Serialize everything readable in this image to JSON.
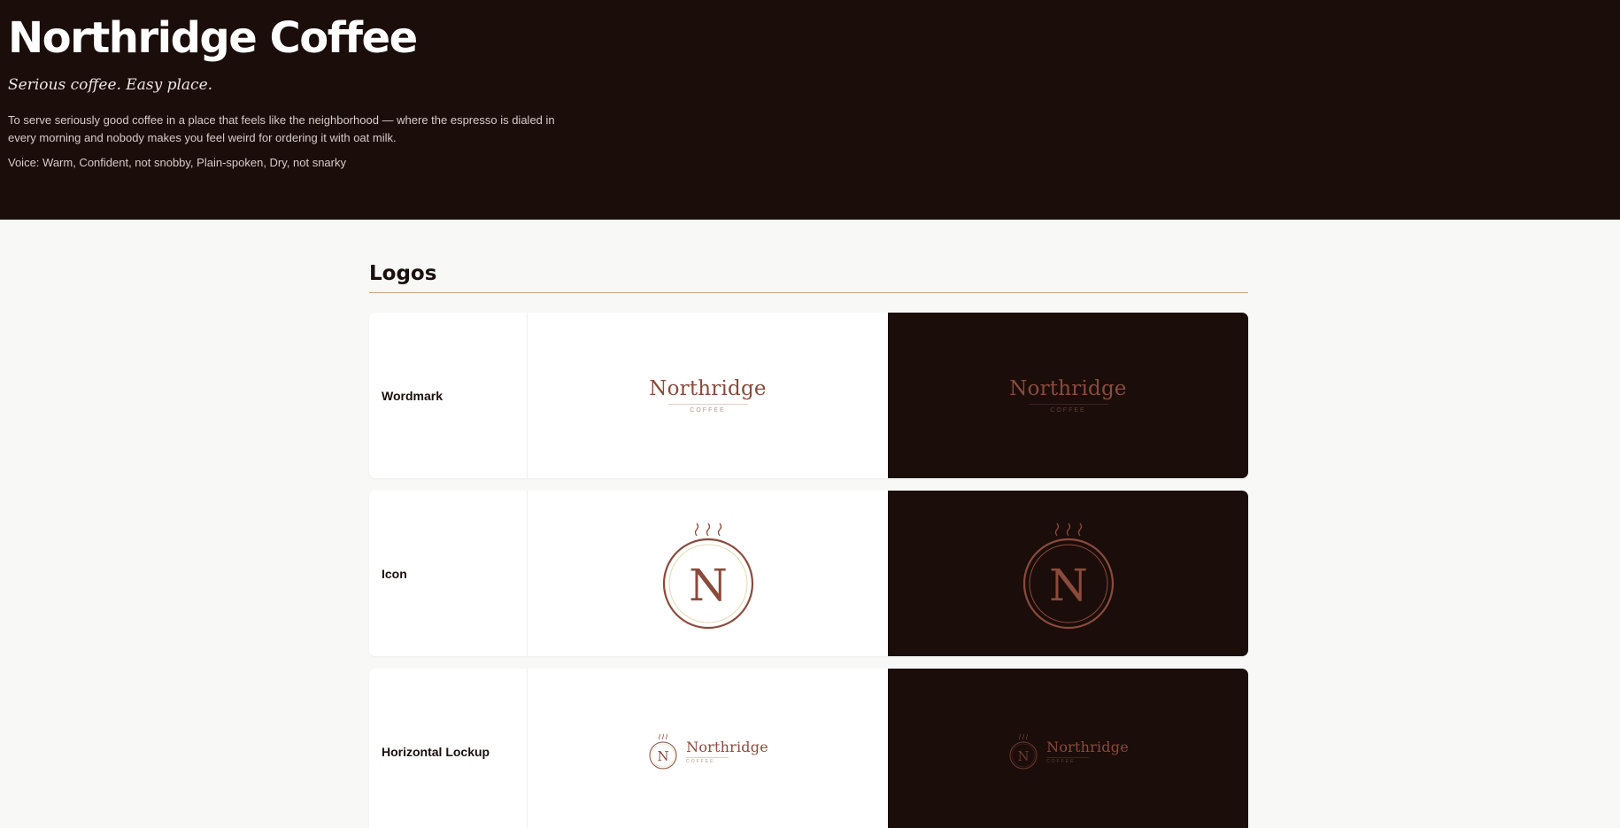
{
  "brand": {
    "name": "Northridge Coffee",
    "tagline": "Serious coffee. Easy place.",
    "mission": "To serve seriously good coffee in a place that feels like the neighborhood — where the espresso is dialed in every morning and nobody makes you feel weird for ordering it with oat milk.",
    "voice": "Voice: Warm, Confident, not snobby, Plain-spoken, Dry, not snarky"
  },
  "colors": {
    "espresso_dark": "#1b0d0a",
    "rust": "#8a4b3c",
    "gold_rule": "#c9a77e",
    "background": "#f8f8f7"
  },
  "logos_section": {
    "title": "Logos",
    "items": [
      {
        "label": "Wordmark",
        "name": "Northridge",
        "sub": "COFFEE"
      },
      {
        "label": "Icon",
        "letter": "N"
      },
      {
        "label": "Horizontal Lockup",
        "letter": "N",
        "name": "Northridge",
        "sub": "COFFEE"
      }
    ]
  },
  "icons": [
    "steam-icon",
    "circle-n-monogram-icon"
  ]
}
